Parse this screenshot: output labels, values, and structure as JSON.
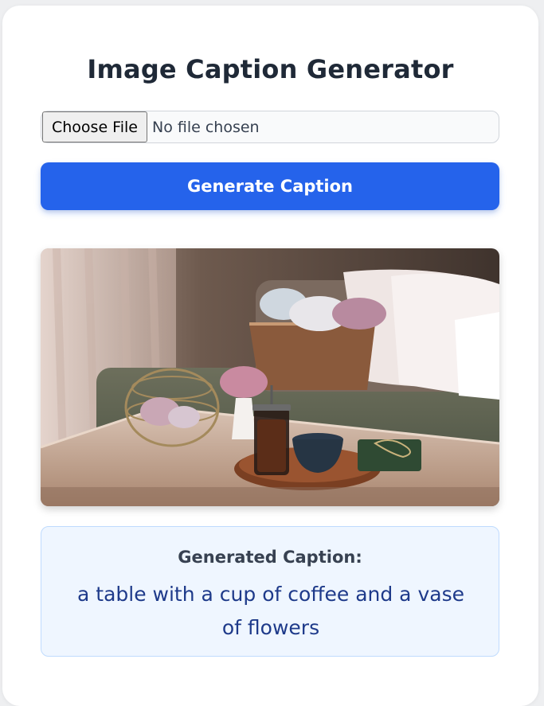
{
  "app": {
    "title": "Image Caption Generator"
  },
  "file_input": {
    "button_label": "Choose File",
    "status_text": "No file chosen"
  },
  "generate_button": {
    "label": "Generate Caption"
  },
  "preview": {
    "alt": "Uploaded photo preview"
  },
  "result": {
    "heading": "Generated Caption:",
    "caption": "a table with a cup of coffee and a vase of flowers"
  },
  "colors": {
    "accent": "#2563eb",
    "caption_bg": "#eff6ff",
    "caption_text": "#1e3a8a"
  }
}
